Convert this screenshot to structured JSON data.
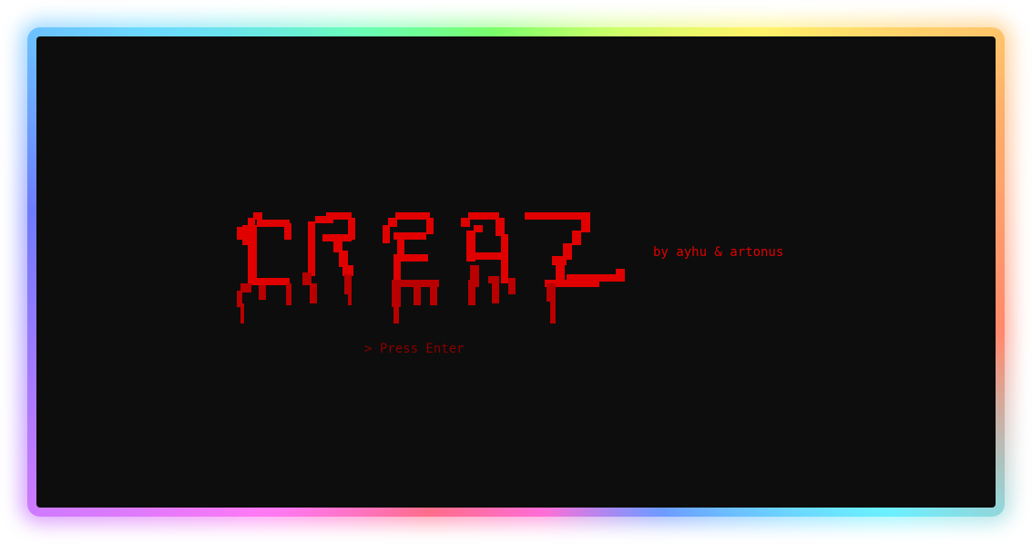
{
  "game": {
    "title_logo_text": "CREAZ",
    "credits": "by ayhu & artonus",
    "prompt": "> Press Enter"
  },
  "colors": {
    "screen_bg": "#0d0d0d",
    "logo_red": "#e00000",
    "logo_dark_red": "#b80000",
    "prompt_red": "#8a0000"
  }
}
